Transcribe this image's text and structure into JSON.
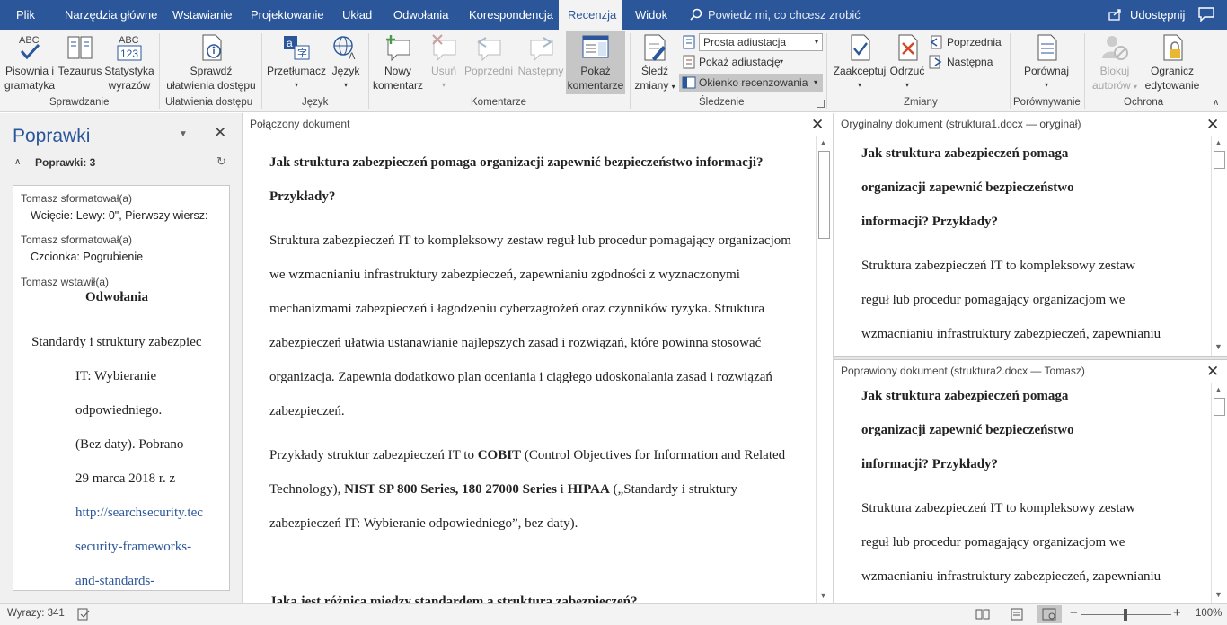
{
  "tabs": [
    "Plik",
    "Narzędzia główne",
    "Wstawianie",
    "Projektowanie",
    "Układ",
    "Odwołania",
    "Korespondencja",
    "Recenzja",
    "Widok"
  ],
  "tellme": "Powiedz mi, co chcesz zrobić",
  "share": "Udostępnij",
  "ribbon": {
    "spelling": [
      "Pisownia i",
      "gramatyka"
    ],
    "thesaurus": "Tezaurus",
    "wordcount": [
      "Statystyka",
      "wyrazów"
    ],
    "check_access": [
      "Sprawdź",
      "ułatwienia dostępu"
    ],
    "group_proofing": "Sprawdzanie",
    "group_access": "Ułatwienia dostępu",
    "translate": "Przetłumacz",
    "language": "Język",
    "group_language": "Język",
    "new_comment": [
      "Nowy",
      "komentarz"
    ],
    "delete": "Usuń",
    "previous": "Poprzedni",
    "next": "Następny",
    "show_comments": [
      "Pokaż",
      "komentarze"
    ],
    "group_comments": "Komentarze",
    "track_changes": [
      "Śledź",
      "zmiany"
    ],
    "markup_dropdown": "Prosta adiustacja",
    "show_markup": "Pokaż adiustację",
    "reviewing_pane": "Okienko recenzowania",
    "group_tracking": "Śledzenie",
    "accept": "Zaakceptuj",
    "reject": "Odrzuć",
    "prev_change": "Poprzednia",
    "next_change": "Następna",
    "group_changes": "Zmiany",
    "compare": "Porównaj",
    "group_compare": "Porównywanie",
    "block_authors": [
      "Blokuj",
      "autorów"
    ],
    "restrict_editing": [
      "Ogranicz",
      "edytowanie"
    ],
    "group_protect": "Ochrona"
  },
  "pane": {
    "title": "Poprawki",
    "count": "Poprawki: 3",
    "rev1_author": "Tomasz sformatował(a)",
    "rev1_detail": "Wcięcie: Lewy: 0\", Pierwszy wiersz:",
    "rev2_author": "Tomasz sformatował(a)",
    "rev2_detail": "Czcionka: Pogrubienie",
    "rev3_author": "Tomasz wstawił(a)",
    "rev3_heading": "Odwołania",
    "rev3_lines": [
      "Standardy i struktury zabezpiec",
      "IT: Wybieranie",
      "odpowiedniego.",
      "(Bez daty). Pobrano",
      "29 marca 2018 r. z"
    ],
    "rev3_links": [
      "http://searchsecurity.tec",
      "security-frameworks-",
      "and-standards-"
    ]
  },
  "doc": {
    "title": "Połączony dokument",
    "h1": "Jak struktura zabezpieczeń pomaga organizacji zapewnić bezpieczeństwo informacji? Przykłady?",
    "p1": "Struktura zabezpieczeń IT to kompleksowy zestaw reguł lub procedur pomagający organizacjom we wzmacnianiu infrastruktury zabezpieczeń, zapewnianiu zgodności z wyznaczonymi mechanizmami zabezpieczeń i łagodzeniu cyberzagrożeń oraz czynników ryzyka. Struktura zabezpieczeń ułatwia ustanawianie najlepszych zasad i rozwiązań, które powinna stosować organizacja. Zapewnia dodatkowo plan oceniania i ciągłego udoskonalania zasad i rozwiązań zabezpieczeń.",
    "p2_a": "Przykłady struktur zabezpieczeń IT to ",
    "p2_b": "COBIT",
    "p2_c": " (Control Objectives for Information and Related Technology), ",
    "p2_d": "NIST SP 800 Series, 180 27000 Series",
    "p2_e": " i ",
    "p2_f": "HIPAA",
    "p2_g": " („Standardy i struktury zabezpieczeń IT: Wybieranie odpowiedniego”, bez daty).",
    "h2": "Jaka jest różnica między standardem a strukturą zabezpieczeń?"
  },
  "original": {
    "title": "Oryginalny dokument (struktura1.docx — oryginał)",
    "h_lines": [
      "Jak struktura zabezpieczeń pomaga",
      "organizacji zapewnić bezpieczeństwo",
      "informacji? Przykłady?"
    ],
    "p_lines": [
      "Struktura zabezpieczeń IT to kompleksowy zestaw",
      "reguł lub procedur pomagający organizacjom we",
      "wzmacnianiu infrastruktury zabezpieczeń, zapewnianiu"
    ]
  },
  "revised": {
    "title": "Poprawiony dokument (struktura2.docx — Tomasz)",
    "h_lines": [
      "Jak struktura zabezpieczeń pomaga",
      "organizacji zapewnić bezpieczeństwo",
      "informacji? Przykłady?"
    ],
    "p_lines": [
      "Struktura zabezpieczeń IT to kompleksowy zestaw",
      "reguł lub procedur pomagający organizacjom we",
      "wzmacnianiu infrastruktury zabezpieczeń, zapewnianiu"
    ]
  },
  "status": {
    "words": "Wyrazy: 341",
    "zoom": "100%",
    "zoom_minus": "−",
    "zoom_plus": "+"
  },
  "colors": {
    "accent": "#2b579a",
    "link": "#2b579a"
  }
}
